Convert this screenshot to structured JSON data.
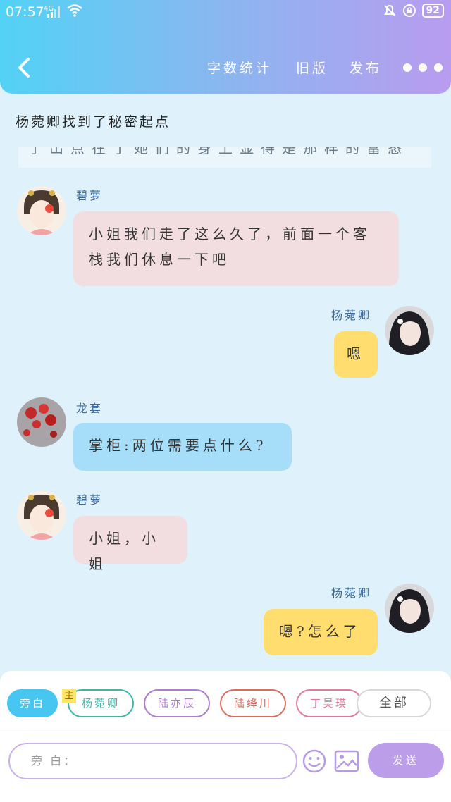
{
  "status": {
    "time": "07:57",
    "network": "4G",
    "battery": "92"
  },
  "nav": {
    "word_count": "字数统计",
    "old_version": "旧版",
    "publish": "发布"
  },
  "story_title": "杨菀卿找到了秘密起点",
  "partial_text": "了出点在了她们的身上显得是那样的富态",
  "messages": [
    {
      "sender": "碧萝",
      "text": "小姐我们走了这么久了，前面一个客栈我们休息一下吧"
    },
    {
      "sender": "杨菀卿",
      "text": "嗯"
    },
    {
      "sender": "龙套",
      "text": "掌柜:两位需要点什么?"
    },
    {
      "sender": "碧萝",
      "text": "小姐，小姐"
    },
    {
      "sender": "杨菀卿",
      "text": "嗯?怎么了"
    }
  ],
  "characters": {
    "narration": "旁白",
    "main_badge": "主",
    "yang": "杨菀卿",
    "lu_yichen": "陆亦辰",
    "lu_jingchuan": "陆绛川",
    "ding": "丁昊瑛",
    "all": "全部"
  },
  "input": {
    "placeholder": "旁 白："
  },
  "send_label": "发送",
  "colors": {
    "header_start": "#52d2f5",
    "header_end": "#b99cef",
    "pink_bubble": "#f2dde0",
    "yellow_bubble": "#ffdd6e",
    "blue_bubble": "#a6defa",
    "send": "#bb9de9"
  }
}
